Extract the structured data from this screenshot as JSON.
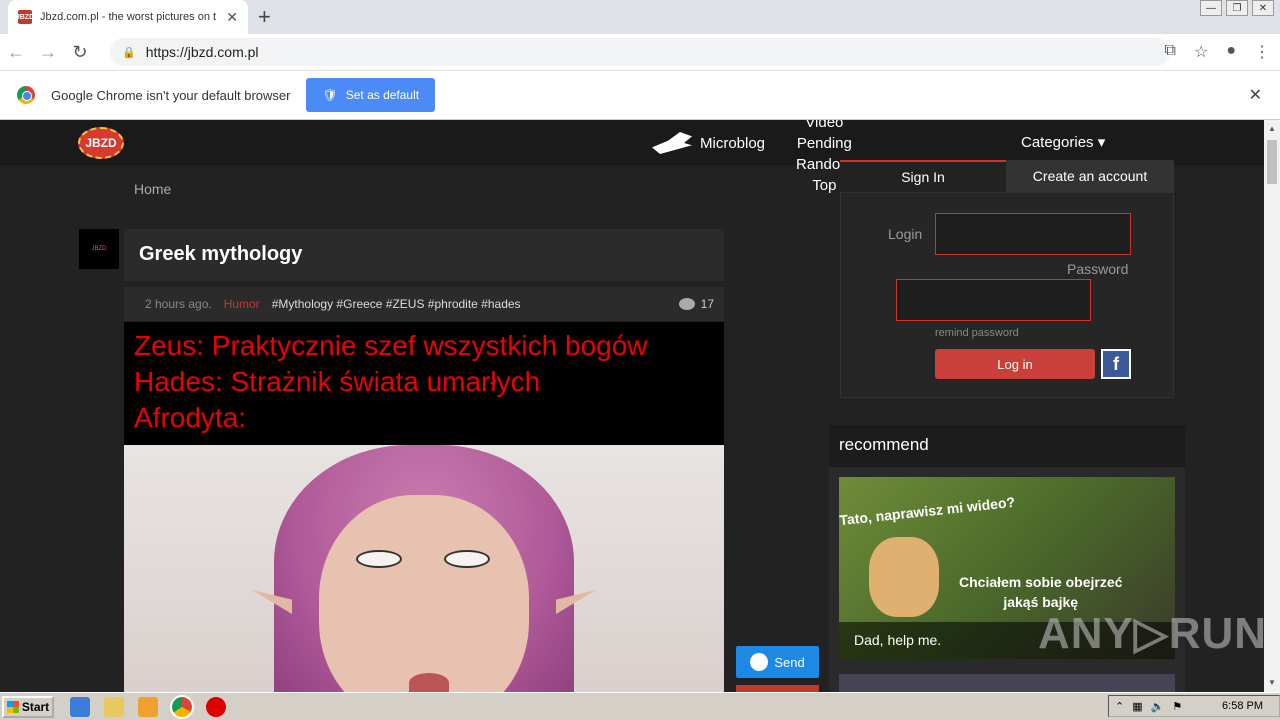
{
  "browser": {
    "tab_title": "Jbzd.com.pl - the worst pictures on t",
    "url": "https://jbzd.com.pl",
    "infobar_text": "Google Chrome isn't your default browser",
    "set_default_label": "Set as default"
  },
  "site": {
    "logo": "JBZD",
    "nav": {
      "microblog": "Microblog",
      "stack": [
        "Video",
        "Pending",
        "Random",
        "Top"
      ],
      "categories": "Categories ▾"
    },
    "breadcrumb": "Home"
  },
  "post": {
    "title": "Greek mythology",
    "time": "2 hours ago.",
    "category": "Humor",
    "tags": "#Mythology #Greece #ZEUS #phrodite #hades",
    "comments": "17",
    "caption_lines": [
      "Zeus: Praktycznie szef wszystkich bogów",
      "Hades: Strażnik świata umarłych",
      "Afrodyta:"
    ],
    "send_label": "Send"
  },
  "login": {
    "tab_signin": "Sign In",
    "tab_create": "Create an account",
    "login_label": "Login",
    "password_label": "Password",
    "remind": "remind password",
    "button": "Log in",
    "fb": "f"
  },
  "recommend": {
    "heading": "recommend",
    "text_top": "Tato, naprawisz mi wideo?",
    "text_mid_1": "Chciałem sobie obejrzeć",
    "text_mid_2": "jakąś bajkę",
    "caption": "Dad, help me."
  },
  "watermark": "ANY▷RUN",
  "taskbar": {
    "start": "Start",
    "clock": "6:58 PM"
  }
}
